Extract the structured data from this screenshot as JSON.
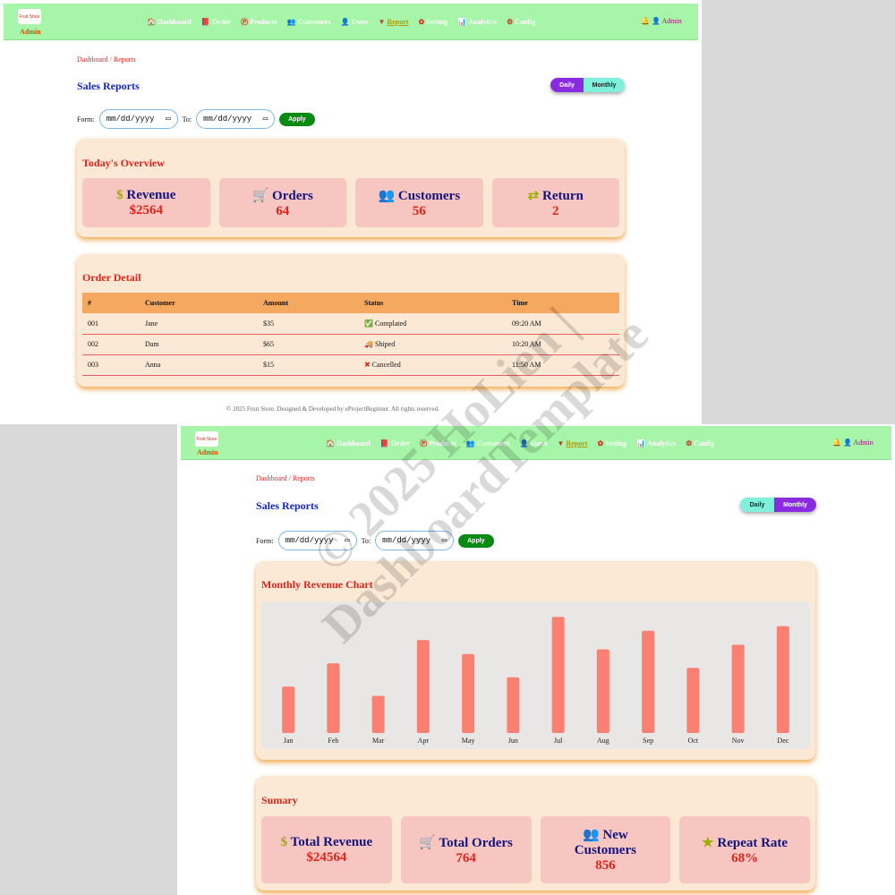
{
  "nav": {
    "admin_label": "Admin",
    "logo_text": "Fruit Store",
    "items": [
      {
        "icon": "🏠",
        "label": "Dashboard"
      },
      {
        "icon": "📕",
        "label": "Order"
      },
      {
        "icon": "Ⓟ",
        "label": "Products"
      },
      {
        "icon": "👥",
        "label": "Customers"
      },
      {
        "icon": "👤",
        "label": "Users"
      },
      {
        "icon": "▼",
        "label": "Report"
      },
      {
        "icon": "✿",
        "label": "Setting"
      },
      {
        "icon": "📊",
        "label": "Analytics"
      },
      {
        "icon": "⚙",
        "label": "Config"
      }
    ],
    "user_label": "🔔 👤 Admin",
    "active": "Report"
  },
  "breadcrumb": "Dashboard / Reports",
  "title": "Sales Reports",
  "toggle": {
    "daily": "Daily",
    "monthly": "Monthly"
  },
  "filter": {
    "from_label": "Form:",
    "to_label": "To:",
    "date_placeholder": "mm/dd/yyyy",
    "apply": "Apply"
  },
  "overview": {
    "title": "Today's Overview",
    "tiles": [
      {
        "icon": "$",
        "label": "Revenue",
        "value": "$2564"
      },
      {
        "icon": "🛒",
        "label": "Orders",
        "value": "64"
      },
      {
        "icon": "👥",
        "label": "Customers",
        "value": "56"
      },
      {
        "icon": "⇄",
        "label": "Return",
        "value": "2"
      }
    ]
  },
  "orders": {
    "title": "Order Detail",
    "columns": [
      "#",
      "Customer",
      "Amount",
      "Status",
      "Time"
    ],
    "rows": [
      {
        "id": "001",
        "customer": "Jane",
        "amount": "$35",
        "status": "Complated",
        "status_icon": "✅",
        "time": "09:20 AM"
      },
      {
        "id": "002",
        "customer": "Dam",
        "amount": "$65",
        "status": "Shiped",
        "status_icon": "🚚",
        "time": "10:20 AM"
      },
      {
        "id": "003",
        "customer": "Anna",
        "amount": "$15",
        "status": "Cancelled",
        "status_icon": "✖",
        "time": "11:50 AM"
      }
    ]
  },
  "footer": "© 2025 Fruit Store. Designed & Developed by eProjectBeginner. All rights reserved.",
  "monthly_chart_title": "Monthly Revenue Chart",
  "chart_data": {
    "type": "bar",
    "categories": [
      "Jan",
      "Feb",
      "Mar",
      "Apr",
      "May",
      "Jun",
      "Jul",
      "Aug",
      "Sep",
      "Oct",
      "Nov",
      "Dec"
    ],
    "values": [
      50,
      75,
      40,
      100,
      85,
      60,
      125,
      90,
      110,
      70,
      95,
      115
    ],
    "ylim": [
      0,
      130
    ],
    "grid": false,
    "color": "#fa8072"
  },
  "summary": {
    "title": "Sumary",
    "tiles": [
      {
        "icon": "$",
        "label": "Total Revenue",
        "value": "$24564"
      },
      {
        "icon": "🛒",
        "label": "Total Orders",
        "value": "764"
      },
      {
        "icon": "👥",
        "label": "New Customers",
        "value": "856"
      },
      {
        "icon": "★",
        "label": "Repeat Rate",
        "value": "68%"
      }
    ]
  },
  "watermark": [
    "© 2025 HoLien |",
    "DashboardTemplate"
  ],
  "colors": {
    "nav_bg": "#a6f5a8",
    "card_bg": "#fbe9d5",
    "tile_bg": "#f7c6c0",
    "accent_red": "#e0241c",
    "title_blue": "#1426c8",
    "toggle_active": "#8a2be2",
    "toggle_inactive": "#7ff0dc",
    "apply_green": "#0a8a12"
  }
}
